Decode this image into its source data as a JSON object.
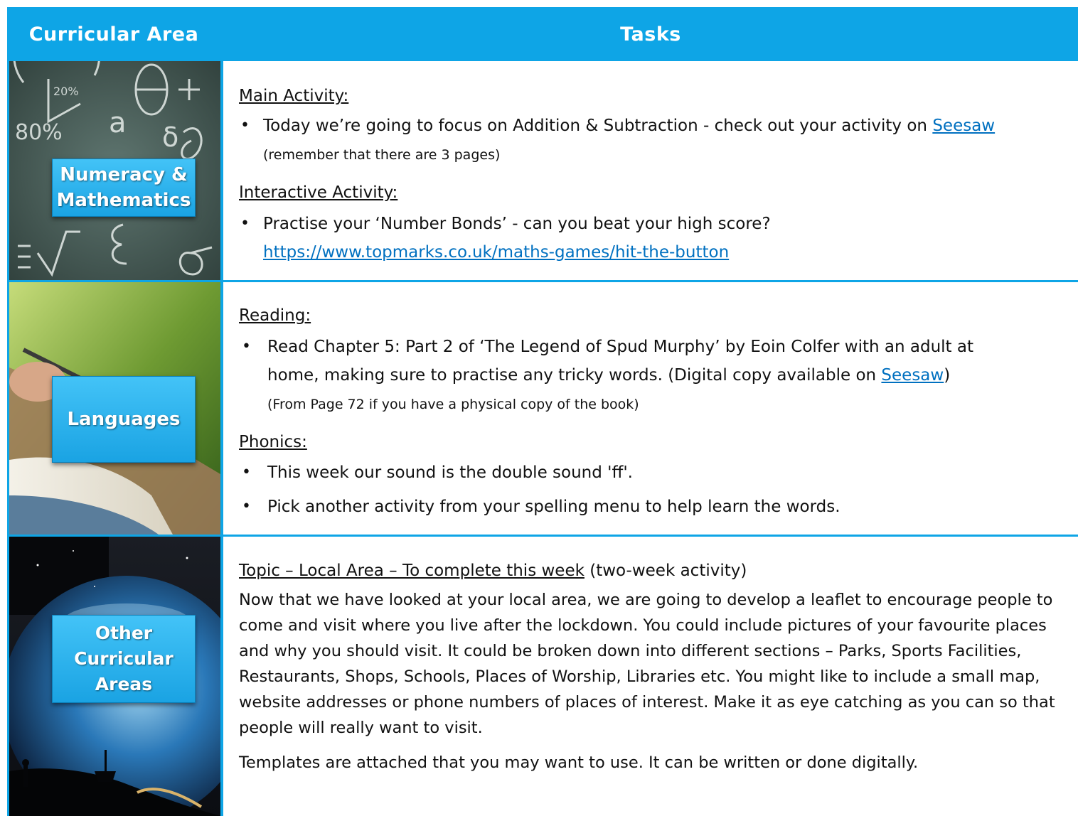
{
  "header": {
    "col1": "Curricular Area",
    "col2": "Tasks"
  },
  "numeracy": {
    "label": "Numeracy & Mathematics",
    "main_heading": "Main Activity:",
    "main_text": "Today we’re going to focus on Addition & Subtraction - check out your activity on ",
    "main_link": "Seesaw",
    "main_note": "(remember that there are 3 pages)",
    "interactive_heading": "Interactive Activity:",
    "interactive_text": "Practise your ‘Number Bonds’ - can you beat your high score?",
    "interactive_link": "https://www.topmarks.co.uk/maths-games/hit-the-button",
    "chalk_marks": [
      "20%",
      "80%",
      "θ",
      "+",
      "−",
      "a",
      "δ",
      "Σ",
      "V",
      "ε",
      "σ"
    ]
  },
  "languages": {
    "label": "Languages",
    "reading_heading": "Reading:",
    "reading_line1": "Read Chapter 5: Part 2 of ‘The Legend of Spud Murphy’ by Eoin Colfer with an adult at",
    "reading_line2": "home, making sure to practise any tricky words. (Digital copy available on ",
    "reading_link": "Seesaw",
    "reading_line2_end": ")",
    "reading_note": "(From Page 72 if you have a physical copy of the book)",
    "phonics_heading": "Phonics:",
    "phonics_1": "This week our sound is the double sound 'ff'.",
    "phonics_2": "Pick another activity from your spelling menu to help learn the words."
  },
  "other": {
    "label": "Other Curricular Areas",
    "topic_heading": "Topic – Local Area – To complete this week",
    "topic_suffix": " (two-week activity)",
    "para1": "Now that we have looked at your local area, we are going to develop a leaflet to encourage people to come and visit where you live after the lockdown. You could include pictures of your favourite places and why you should visit. It could be broken down into different sections – Parks, Sports Facilities, Restaurants, Shops, Schools, Places of Worship, Libraries etc. You might like to include a small map, website addresses or phone numbers of places of interest. Make it as eye catching as you can so that people will really want to visit.",
    "para2": "Templates are attached that you may want to use. It can be written or done digitally."
  },
  "bullet": "•",
  "colors": {
    "accent": "#0ea5e6",
    "link": "#0070c0"
  }
}
